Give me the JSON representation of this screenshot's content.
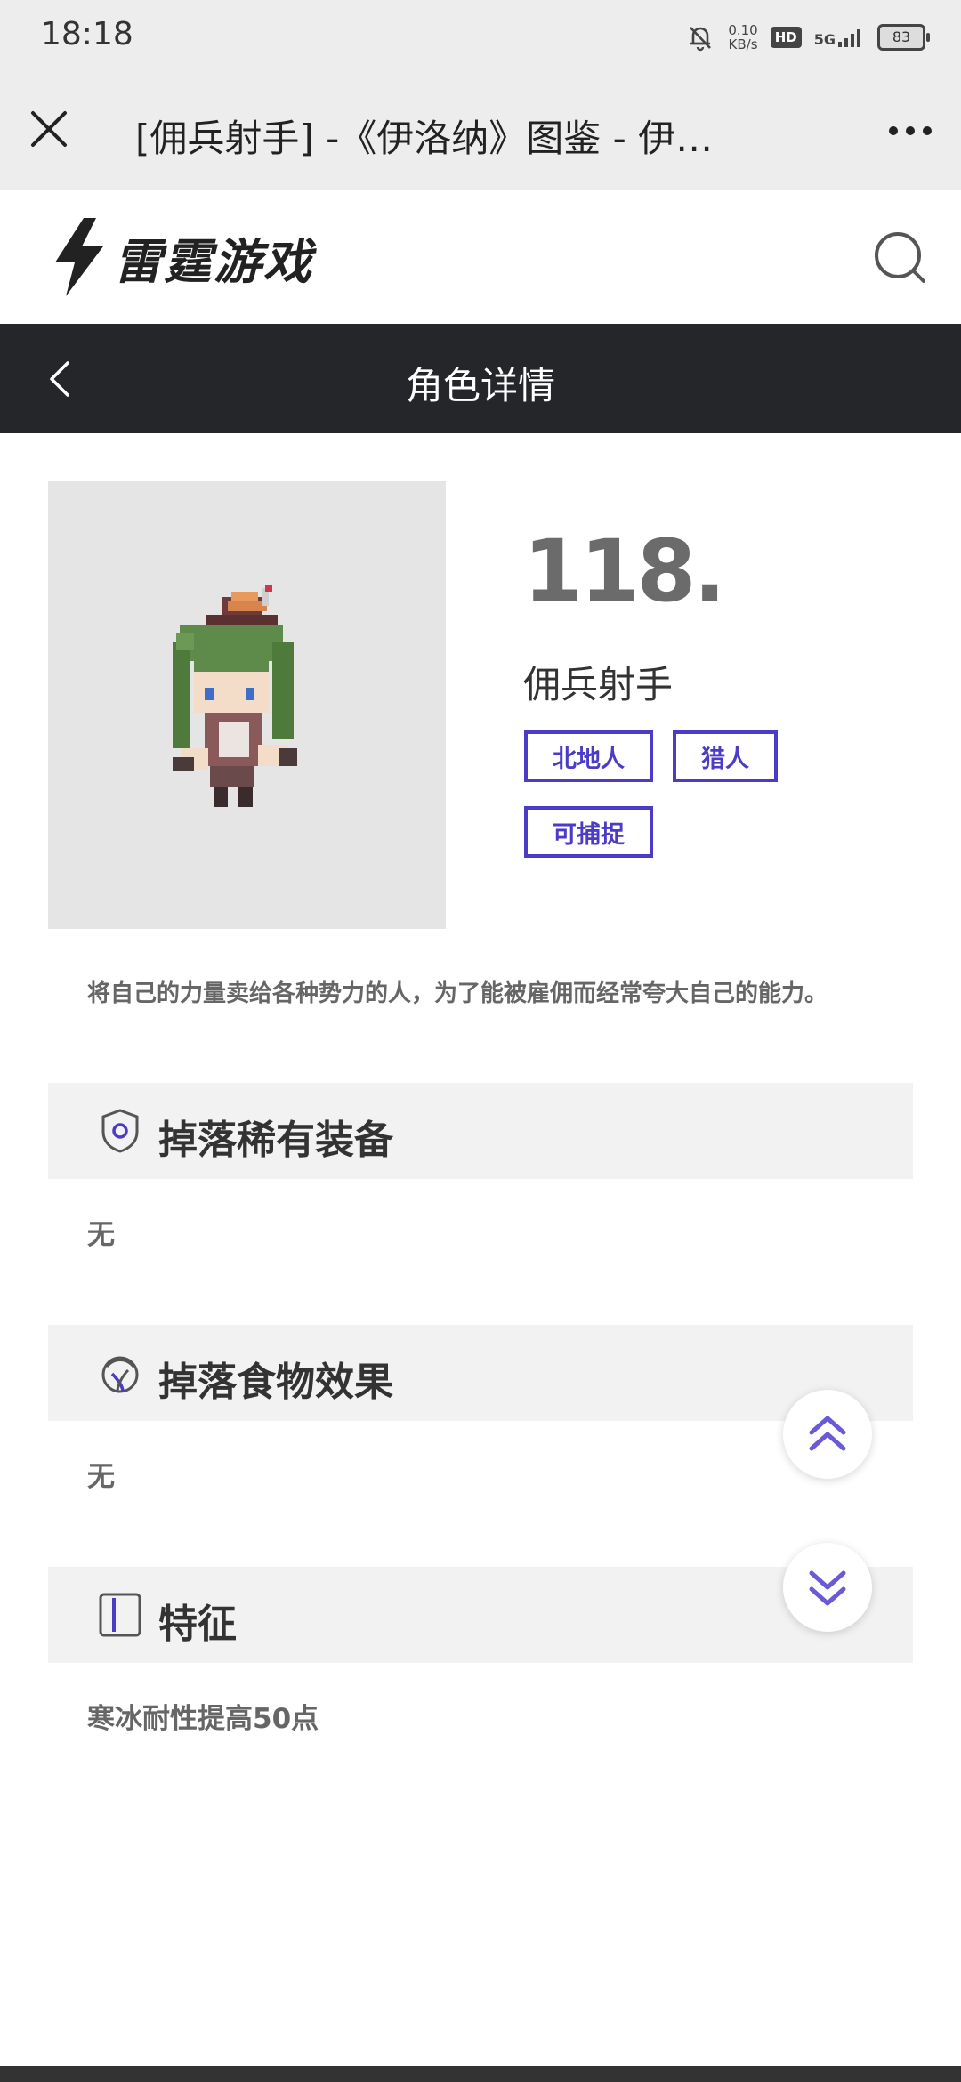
{
  "status_bar": {
    "time": "18:18",
    "net_speed_value": "0.10",
    "net_speed_unit": "KB/s",
    "hd_label": "HD",
    "signal_label": "5G",
    "battery": "83"
  },
  "browser": {
    "title": "[佣兵射手] -《伊洛纳》图鉴 - 伊…"
  },
  "site": {
    "logo_text": "雷霆游戏"
  },
  "page_nav": {
    "title": "角色详情"
  },
  "character": {
    "number": "118.",
    "name": "佣兵射手",
    "tags": [
      "北地人",
      "猎人",
      "可捕捉"
    ],
    "description": "将自己的力量卖给各种势力的人，为了能被雇佣而经常夸大自己的能力。"
  },
  "sections": [
    {
      "title": "掉落稀有装备",
      "content": "无",
      "icon": "shield-icon"
    },
    {
      "title": "掉落食物效果",
      "content": "无",
      "icon": "food-icon"
    },
    {
      "title": "特征",
      "content": "寒冰耐性提高50点",
      "icon": "panel-icon"
    }
  ],
  "colors": {
    "accent": "#4b3bc7",
    "nav_bg": "#24262a",
    "section_bg": "#f2f2f2"
  }
}
